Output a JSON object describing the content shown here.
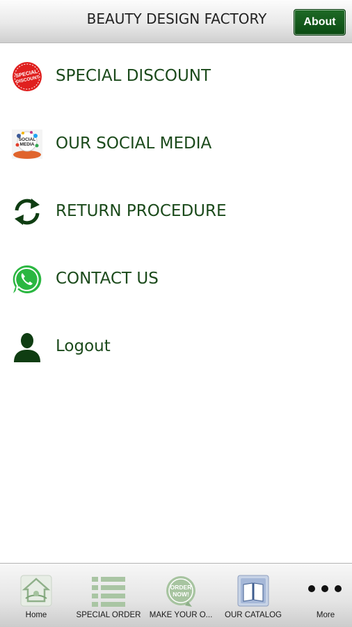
{
  "header": {
    "title": "BEAUTY DESIGN FACTORY",
    "about_label": "About"
  },
  "menu": [
    {
      "label": "SPECIAL DISCOUNT",
      "icon": "special-discount-icon",
      "icon_text": "SPECIAL DISCOUNT"
    },
    {
      "label": "OUR SOCIAL MEDIA",
      "icon": "social-media-icon",
      "icon_text": "SOCIAL MEDIA"
    },
    {
      "label": "RETURN PROCEDURE",
      "icon": "refresh-icon"
    },
    {
      "label": "CONTACT US",
      "icon": "whatsapp-icon"
    },
    {
      "label": "Logout",
      "icon": "user-icon"
    }
  ],
  "tabs": [
    {
      "label": "Home",
      "icon": "home-icon"
    },
    {
      "label": "SPECIAL ORDER",
      "icon": "list-icon"
    },
    {
      "label": "MAKE YOUR O...",
      "icon": "order-now-icon",
      "icon_text": "ORDER NOW!"
    },
    {
      "label": "OUR CATALOG",
      "icon": "book-icon"
    },
    {
      "label": "More",
      "icon": "more-icon"
    }
  ],
  "colors": {
    "accent": "#0b4a12",
    "text_green": "#1b4a1b",
    "whatsapp_green": "#2bb741",
    "discount_red": "#e0201f"
  }
}
